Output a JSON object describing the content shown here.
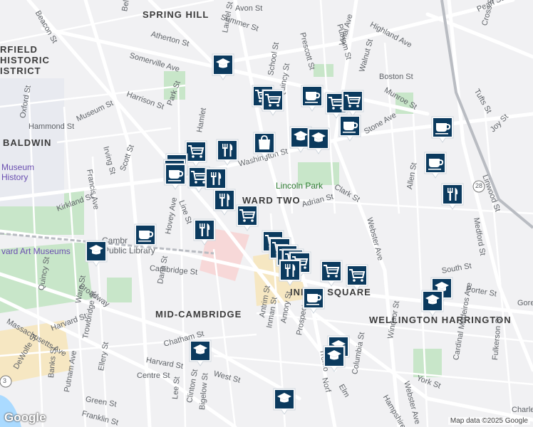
{
  "map": {
    "attribution": "Map data ©2025 Google",
    "logo": "Google",
    "route_shields": [
      "28",
      "3"
    ],
    "colors": {
      "pin": "#0b3a5e",
      "park": "#c8e6c9",
      "road": "#ffffff",
      "highlight": "#f6e7c2"
    }
  },
  "labels": {
    "neighborhoods": [
      "SPRING HILL",
      "BALDWIN",
      "WARD TWO",
      "MID-CAMBRIDGE",
      "WELLINGTON HARRINGTON"
    ],
    "districts": [
      "RFIELD",
      "HISTORIC",
      "ISTRICT"
    ],
    "places": [
      "Lincoln Park",
      "Museum",
      "History",
      "vard Art Museums",
      "Cambr",
      "Public Library",
      "INMAN SQUARE"
    ],
    "streets": [
      "Somerville Ave",
      "Beacon St",
      "Summer St",
      "Highland Ave",
      "Pearl St",
      "Cross St",
      "Atherton St",
      "Avon St",
      "Prescott St",
      "Putnam St",
      "Vinal Ave",
      "Walnut St",
      "Boston St",
      "Munroe St",
      "Tufts St",
      "Harrison St",
      "Park St",
      "Museum St",
      "Hammond St",
      "Oxford St",
      "Irving St",
      "Francis Ave",
      "Scott St",
      "Washington St",
      "Stone Ave",
      "Clark St",
      "Adrian St",
      "Webster Ave",
      "Allen St",
      "Linwood St",
      "Medford St",
      "Joy St",
      "Kirkland St",
      "Line St",
      "Hovey Ave",
      "Dana St",
      "Quincy St",
      "Ware St",
      "Broadway",
      "Cambridge St",
      "Antrim St",
      "Inman St",
      "Amory St",
      "Prospect",
      "Columbia St",
      "Windsor St",
      "Porter St",
      "South St",
      "Harvard St",
      "Chatham St",
      "Harvard St",
      "Centre St",
      "West St",
      "Massachusetts Ave",
      "Trowbridge St",
      "Ellery St",
      "DeWolfe St",
      "Banks St",
      "Putnam Ave",
      "Green St",
      "Franklin St",
      "Lee St",
      "Clinton St",
      "Bigelow St",
      "Hampshire St",
      "Webster Ave",
      "Fulkerson St",
      "York St",
      "Cardinal Medeiros Ave",
      "Charle",
      "Tremo",
      "Norf",
      "Elm",
      "School St",
      "Quincy St",
      "Belm",
      "Laurel St",
      "Hamlet",
      "Gore"
    ]
  },
  "markers": [
    {
      "kind": "school"
    },
    {
      "kind": "grocery"
    },
    {
      "kind": "grocery"
    },
    {
      "kind": "cafe"
    },
    {
      "kind": "grocery"
    },
    {
      "kind": "grocery"
    },
    {
      "kind": "cafe"
    },
    {
      "kind": "school"
    },
    {
      "kind": "school"
    },
    {
      "kind": "shopping"
    },
    {
      "kind": "grocery"
    },
    {
      "kind": "cafe"
    },
    {
      "kind": "restaurant"
    },
    {
      "kind": "grocery"
    },
    {
      "kind": "cafe"
    },
    {
      "kind": "grocery"
    },
    {
      "kind": "restaurant"
    },
    {
      "kind": "restaurant"
    },
    {
      "kind": "restaurant"
    },
    {
      "kind": "grocery"
    },
    {
      "kind": "cafe"
    },
    {
      "kind": "cafe"
    },
    {
      "kind": "cafe"
    },
    {
      "kind": "restaurant"
    },
    {
      "kind": "school"
    },
    {
      "kind": "grocery"
    },
    {
      "kind": "grocery"
    },
    {
      "kind": "grocery"
    },
    {
      "kind": "grocery"
    },
    {
      "kind": "grocery"
    },
    {
      "kind": "restaurant"
    },
    {
      "kind": "grocery"
    },
    {
      "kind": "grocery"
    },
    {
      "kind": "cafe"
    },
    {
      "kind": "school"
    },
    {
      "kind": "school"
    },
    {
      "kind": "school"
    },
    {
      "kind": "school"
    },
    {
      "kind": "school"
    },
    {
      "kind": "school"
    }
  ]
}
